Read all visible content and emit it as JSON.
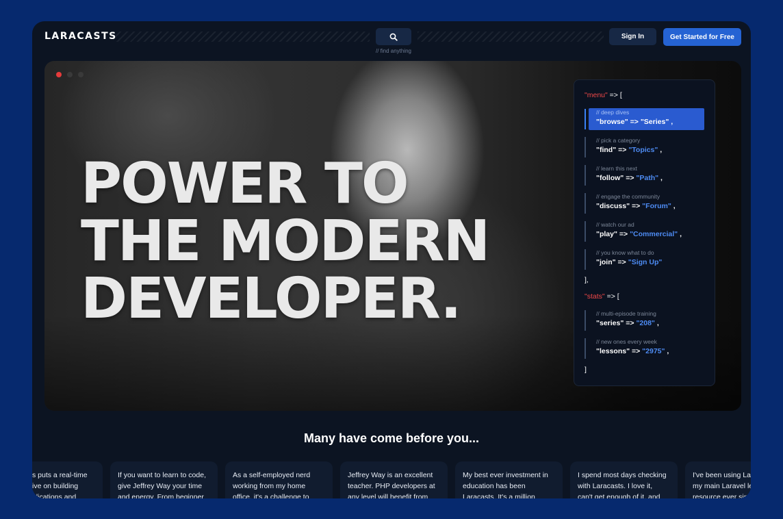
{
  "header": {
    "logo": "LARACASTS",
    "search_hint": "// find anything",
    "sign_in": "Sign In",
    "cta": "Get Started for Free"
  },
  "hero": {
    "headline": [
      "POWER TO",
      "THE MODERN",
      "DEVELOPER."
    ],
    "window_dots": [
      "#e63b3b",
      "#3a3a3a",
      "#3a3a3a"
    ]
  },
  "code_panel": {
    "menu_key": "\"menu\"",
    "arrow_open": "=> [",
    "close_menu": "],",
    "stats_key": "\"stats\"",
    "close_stats": "]",
    "menu_items": [
      {
        "comment": "// deep dives",
        "key": "\"browse\"",
        "arrow": " => ",
        "value": "\"Series\"",
        "suffix": " ,",
        "active": true
      },
      {
        "comment": "// pick a category",
        "key": "\"find\"",
        "arrow": " => ",
        "value": "\"Topics\"",
        "suffix": " ,",
        "active": false
      },
      {
        "comment": "// learn this next",
        "key": "\"follow\"",
        "arrow": " => ",
        "value": "\"Path\"",
        "suffix": " ,",
        "active": false
      },
      {
        "comment": "// engage the community",
        "key": "\"discuss\"",
        "arrow": " => ",
        "value": "\"Forum\"",
        "suffix": " ,",
        "active": false
      },
      {
        "comment": "// watch our ad",
        "key": "\"play\"",
        "arrow": " => ",
        "value": "\"Commercial\"",
        "suffix": " ,",
        "active": false
      },
      {
        "comment": "// you know what to do",
        "key": "\"join\"",
        "arrow": " => ",
        "value": "\"Sign Up\"",
        "suffix": "",
        "active": false
      }
    ],
    "stats_items": [
      {
        "comment": "// multi-episode training",
        "key": "\"series\"",
        "arrow": " => ",
        "value": "\"208\"",
        "suffix": " ,"
      },
      {
        "comment": "// new ones every week",
        "key": "\"lessons\"",
        "arrow": " => ",
        "value": "\"2975\"",
        "suffix": " ,"
      }
    ]
  },
  "testimonials": {
    "title": "Many have come before you...",
    "cards": [
      {
        "lines": [
          "s puts a real-time",
          "ive on building",
          "plications and"
        ]
      },
      {
        "lines": [
          "If you want to learn to code,",
          "give Jeffrey Way your time",
          "and energy. From beginner"
        ]
      },
      {
        "lines": [
          "As a self-employed nerd",
          "working from my home",
          "office, it's a challenge to"
        ]
      },
      {
        "lines": [
          "Jeffrey Way is an excellent",
          "teacher. PHP developers at",
          "any level will benefit from"
        ]
      },
      {
        "lines": [
          "My best ever investment in",
          "education has been",
          "Laracasts. It's a million"
        ]
      },
      {
        "lines": [
          "I spend most days checking",
          "with Laracasts. I love it,",
          "can't get enough of it, and"
        ]
      },
      {
        "lines": [
          "I've been using Lar",
          "my main Laravel le",
          "resource ever sin"
        ]
      }
    ]
  },
  "colors": {
    "page_bg": "#06296e",
    "window_bg": "#0c1422",
    "accent_blue": "#2563d3",
    "code_key_red": "#f04848",
    "code_value_blue": "#4e8cf4"
  },
  "icons": [
    "search-icon"
  ]
}
